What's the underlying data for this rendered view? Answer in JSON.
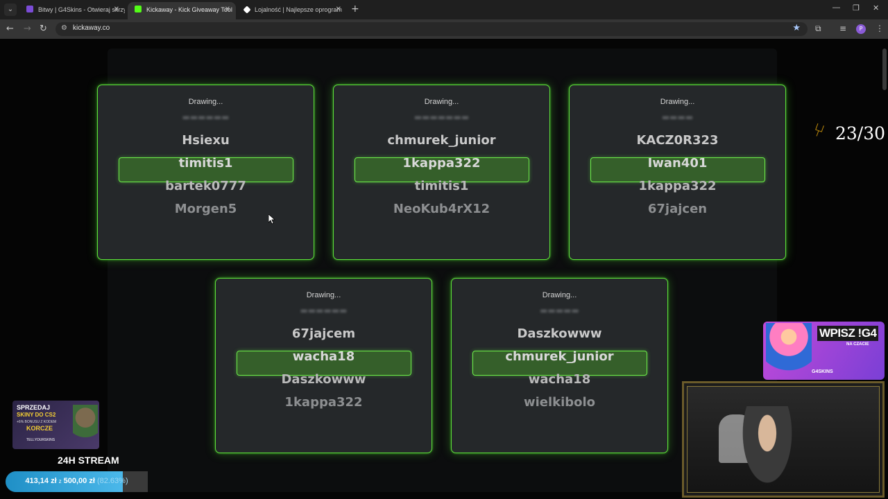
{
  "browser": {
    "tabs": [
      {
        "title": "Bitwy | G4Skins - Otwieraj skrzy",
        "favicon_color": "#7b4cd6",
        "active": false
      },
      {
        "title": "Kickaway - Kick Giveaway Tool",
        "favicon_color": "#53fc18",
        "active": true
      },
      {
        "title": "Lojalność | Najlepsze oprogram",
        "favicon_color": "#ffffff",
        "active": false
      }
    ],
    "url": "kickaway.co",
    "profile_initial": "P"
  },
  "giveaway": {
    "accent_color": "#53fc18",
    "cards": [
      {
        "status": "Drawing...",
        "names": [
          "Hsiexu",
          "timitis1",
          "bartek0777",
          "Morgen5"
        ],
        "highlighted_index": 1
      },
      {
        "status": "Drawing...",
        "names": [
          "chmurek_junior",
          "1kappa322",
          "timitis1",
          "NeoKub4rX12"
        ],
        "highlighted_index": 1
      },
      {
        "status": "Drawing...",
        "names": [
          "KACZ0R323",
          "Iwan401",
          "1kappa322",
          "67jajcen"
        ],
        "highlighted_index": 1
      },
      {
        "status": "Drawing...",
        "names": [
          "67jajcem",
          "wacha18",
          "Daszkowww",
          "1kappa322"
        ],
        "highlighted_index": 1
      },
      {
        "status": "Drawing...",
        "names": [
          "Daszkowww",
          "chmurek_junior",
          "wacha18",
          "wielkibolo"
        ],
        "highlighted_index": 1
      }
    ]
  },
  "counter": {
    "icon": "fork-icon",
    "text": "23/30"
  },
  "overlay": {
    "promo": {
      "line1": "SPRZEDAJ",
      "line2": "SKINY DO CS2",
      "line3": "+6% BONUSU Z KODEM",
      "line4": "KORCZE",
      "brand": "TELLYOURSKINS"
    },
    "stream_title": "24H STREAM",
    "goal": {
      "current": "413,14 zł",
      "target": "500,00 zł",
      "percent_text": "(82.63%)",
      "fraction": 0.8263
    },
    "ad": {
      "title": "WPISZ !G4",
      "subtitle": "NA CZACIE",
      "brand": "G4SKINS"
    }
  }
}
